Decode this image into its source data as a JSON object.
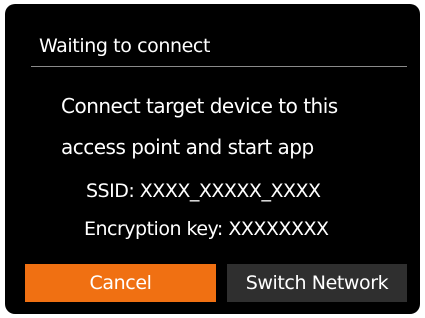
{
  "dialog": {
    "title": "Waiting to connect",
    "message_line1": "Connect target device to this",
    "message_line2": "access point and start app",
    "ssid_line": "SSID: XXXX_XXXXX_XXXX",
    "encryption_line": "Encryption key: XXXXXXXX"
  },
  "buttons": {
    "cancel_label": "Cancel",
    "switch_network_label": "Switch Network"
  },
  "colors": {
    "background": "#000000",
    "accent_selected": "#f07012",
    "button_unselected": "#2f2f2f",
    "text": "#ffffff"
  }
}
